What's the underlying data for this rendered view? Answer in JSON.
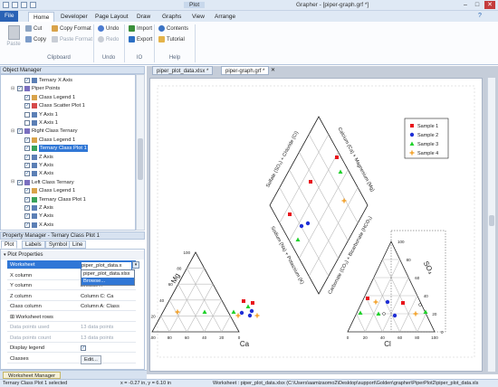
{
  "window": {
    "title_center": "Plot",
    "title_right": "Grapher - [piper-graph.grf *]"
  },
  "menu": {
    "file": "File",
    "tabs": [
      "Home",
      "Developer",
      "Page Layout",
      "Draw",
      "Graphs",
      "View",
      "Arrange"
    ]
  },
  "ribbon": {
    "paste": "Paste",
    "cut": "Cut",
    "copy": "Copy",
    "copy_format": "Copy Format",
    "paste_format": "Paste Format",
    "undo": "Undo",
    "redo": "Redo",
    "import": "Import",
    "export": "Export",
    "contents": "Contents",
    "tutorial": "Tutorial",
    "groups": {
      "clipboard": "Clipboard",
      "undo": "Undo",
      "io": "IO",
      "help": "Help"
    }
  },
  "object_manager": {
    "title": "Object Manager",
    "items": [
      {
        "label": "Ternary X Axis",
        "indent": 2,
        "check": true,
        "icon": "axis"
      },
      {
        "label": "Piper Points",
        "indent": 1,
        "check": true,
        "icon": "group",
        "expand": "-"
      },
      {
        "label": "Class Legend 1",
        "indent": 2,
        "check": true,
        "icon": "legend"
      },
      {
        "label": "Class Scatter Plot 1",
        "indent": 2,
        "check": true,
        "icon": "scatter"
      },
      {
        "label": "Y Axis 1",
        "indent": 2,
        "check": false,
        "icon": "axis"
      },
      {
        "label": "X Axis 1",
        "indent": 2,
        "check": false,
        "icon": "axis"
      },
      {
        "label": "Right Class Ternary",
        "indent": 1,
        "check": true,
        "icon": "group",
        "expand": "-"
      },
      {
        "label": "Class Legend 1",
        "indent": 2,
        "check": true,
        "icon": "legend"
      },
      {
        "label": "Ternary Class Plot 1",
        "indent": 2,
        "check": true,
        "icon": "ternary",
        "selected": true
      },
      {
        "label": "Z Axis",
        "indent": 2,
        "check": true,
        "icon": "axis"
      },
      {
        "label": "Y Axis",
        "indent": 2,
        "check": true,
        "icon": "axis"
      },
      {
        "label": "X Axis",
        "indent": 2,
        "check": true,
        "icon": "axis"
      },
      {
        "label": "Left Class Ternary",
        "indent": 1,
        "check": true,
        "icon": "group",
        "expand": "-"
      },
      {
        "label": "Class Legend 1",
        "indent": 2,
        "check": true,
        "icon": "legend"
      },
      {
        "label": "Ternary Class Plot 1",
        "indent": 2,
        "check": true,
        "icon": "ternary"
      },
      {
        "label": "Z Axis",
        "indent": 2,
        "check": true,
        "icon": "axis"
      },
      {
        "label": "Y Axis",
        "indent": 2,
        "check": true,
        "icon": "axis"
      },
      {
        "label": "X Axis",
        "indent": 2,
        "check": true,
        "icon": "axis"
      }
    ]
  },
  "property_manager": {
    "title": "Property Manager - Ternary Class Plot 1",
    "tabs": [
      "Plot",
      "Labels",
      "Symbol",
      "Line"
    ],
    "section": "Plot Properties",
    "rows": [
      {
        "key": "Worksheet",
        "value": "piper_plot_data.x",
        "highlight": true
      },
      {
        "key": "X column",
        "value": "piper_plot_data.xlsx"
      },
      {
        "key": "Y column",
        "value": "Browse..."
      },
      {
        "key": "Z column",
        "value": "Column C: Ca"
      },
      {
        "key": "Class column",
        "value": "Column A: Class"
      },
      {
        "key": "Worksheet rows",
        "value": "",
        "expand": "+"
      },
      {
        "key": "Data points used",
        "value": "13 data points",
        "disabled": true
      },
      {
        "key": "Data points count",
        "value": "13 data points",
        "disabled": true
      },
      {
        "key": "Display legend",
        "value": "",
        "checkbox": true
      },
      {
        "key": "Classes",
        "value": "Edit...",
        "button": true
      }
    ],
    "dropdown_options": [
      "piper_plot_data.xlsx",
      "Browse..."
    ]
  },
  "doc_tabs": [
    "piper_plot_data.xlsx *",
    "piper-graph.grf *"
  ],
  "worksheet_tab": "Worksheet Manager",
  "status": {
    "left": "Ternary Class Plot 1 selected",
    "coords": "x = -0.27 in, y = 6.10 in",
    "path": "Worksheet : piper_plot_data.xlsx (C:\\Users\\aamizaomo2\\Desktop\\support\\Golden\\grapher\\PiperPlot2\\piper_plot_data.xls"
  },
  "chart": {
    "legend": [
      {
        "label": "Sample 1",
        "color": "#e8141b",
        "shape": "square"
      },
      {
        "label": "Sample 2",
        "color": "#1f2fd6",
        "shape": "circle"
      },
      {
        "label": "Sample 3",
        "color": "#1fd12a",
        "shape": "triangle"
      },
      {
        "label": "Sample 4",
        "color": "#f29a1a",
        "shape": "plus"
      }
    ],
    "diamond_labels": {
      "upper_left": "Sulfate (SO₄) + Chloride (Cl)",
      "upper_right": "Calcium (Ca) + Magnesium (Mg)",
      "lower_left": "Sodium (Na) + Potassium (K)",
      "lower_right": "Carbonate (CO₃) + Bicarbonate (HCO₃)"
    },
    "left_ternary": {
      "apex_label": "Mg",
      "bottom_label": "Ca"
    },
    "right_ternary": {
      "apex_label": "SO₄",
      "bottom_label": "Cl"
    },
    "ticks": [
      "100",
      "80",
      "60",
      "40",
      "20",
      "0"
    ]
  }
}
